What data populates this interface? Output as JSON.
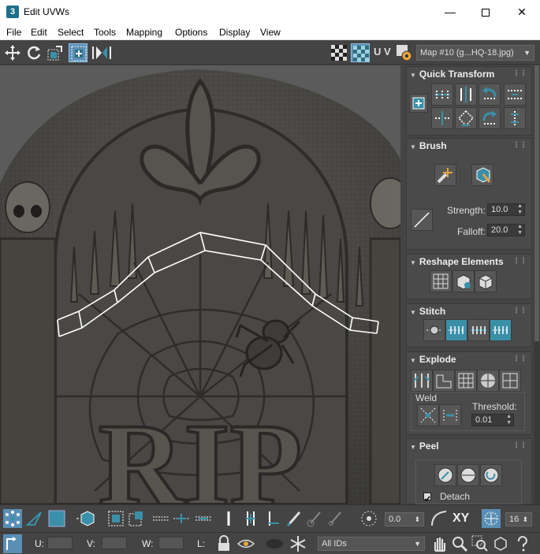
{
  "window": {
    "title": "Edit UVWs",
    "app_icon_text": "3",
    "minimize": "—",
    "close": "✕"
  },
  "menu": [
    "File",
    "Edit",
    "Select",
    "Tools",
    "Mapping",
    "Options",
    "Display",
    "View"
  ],
  "toolbar": {
    "uv_label": "U V",
    "map_select": "Map #10 (g...HQ-18.jpg)"
  },
  "panel": {
    "quick_transform": {
      "title": "Quick Transform"
    },
    "brush": {
      "title": "Brush",
      "strength_label": "Strength:",
      "strength_value": "10.0",
      "falloff_label": "Falloff:",
      "falloff_value": "20.0"
    },
    "reshape": {
      "title": "Reshape Elements"
    },
    "stitch": {
      "title": "Stitch"
    },
    "explode": {
      "title": "Explode",
      "weld_label": "Weld",
      "threshold_label": "Threshold:",
      "threshold_value": "0.01"
    },
    "peel": {
      "title": "Peel",
      "detach_label": "Detach",
      "detach_checked": true
    }
  },
  "bottom": {
    "angle_value": "0.0",
    "xy_label": "XY",
    "grid_value": "16",
    "u_label": "U:",
    "v_label": "V:",
    "w_label": "W:",
    "l_label": "L:",
    "ids_select": "All IDs"
  },
  "viewport": {
    "texture_text": "RIP"
  },
  "colors": {
    "accent": "#3a90a8",
    "active_blue": "#5a8fb5",
    "uv_line": "#ffffff"
  }
}
